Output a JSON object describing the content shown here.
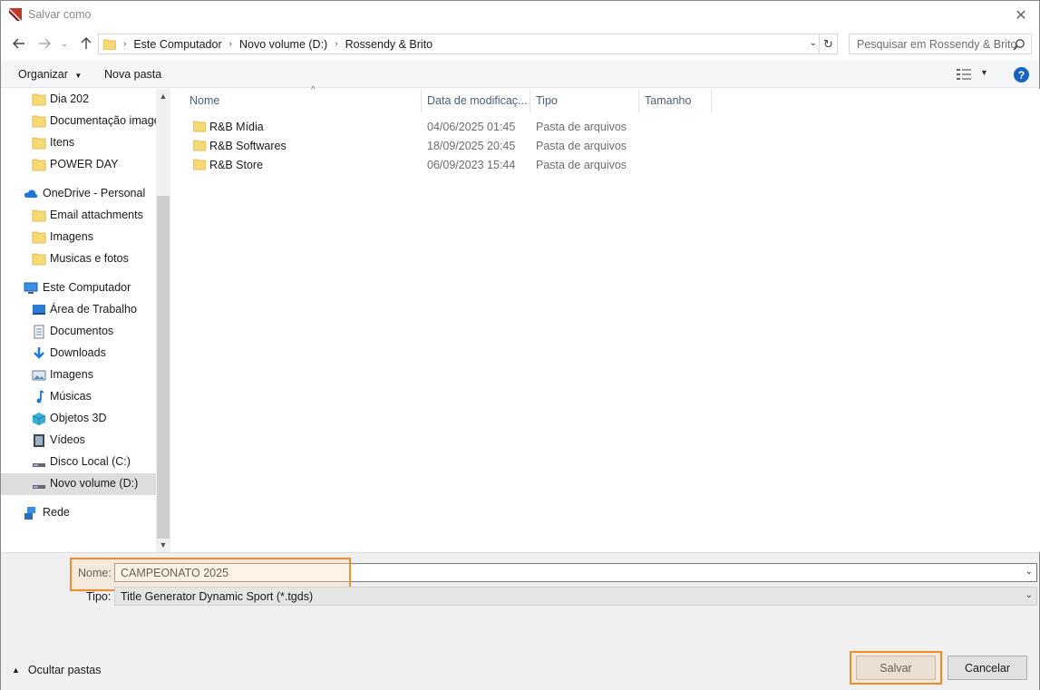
{
  "window": {
    "title": "Salvar como"
  },
  "nav": {
    "breadcrumb": [
      "Este Computador",
      "Novo volume (D:)",
      "Rossendy & Brito"
    ],
    "search_placeholder": "Pesquisar em Rossendy & Brito"
  },
  "toolbar": {
    "organize": "Organizar",
    "new_folder": "Nova pasta"
  },
  "sidebar": {
    "items": [
      {
        "label": "Dia 202",
        "icon": "folder-icon"
      },
      {
        "label": "Documentação image",
        "icon": "folder-icon"
      },
      {
        "label": "Itens",
        "icon": "folder-icon"
      },
      {
        "label": "POWER DAY",
        "icon": "folder-icon"
      },
      {
        "label": "OneDrive - Personal",
        "icon": "cloud-icon"
      },
      {
        "label": "Email attachments",
        "icon": "folder-icon"
      },
      {
        "label": "Imagens",
        "icon": "folder-icon"
      },
      {
        "label": "Musicas e fotos",
        "icon": "folder-icon"
      },
      {
        "label": "Este Computador",
        "icon": "computer-icon"
      },
      {
        "label": "Área de Trabalho",
        "icon": "desktop-icon"
      },
      {
        "label": "Documentos",
        "icon": "documents-icon"
      },
      {
        "label": "Downloads",
        "icon": "download-icon"
      },
      {
        "label": "Imagens",
        "icon": "pictures-icon"
      },
      {
        "label": "Músicas",
        "icon": "music-icon"
      },
      {
        "label": "Objetos 3D",
        "icon": "cube-icon"
      },
      {
        "label": "Vídeos",
        "icon": "video-icon"
      },
      {
        "label": "Disco Local (C:)",
        "icon": "drive-icon"
      },
      {
        "label": "Novo volume (D:)",
        "icon": "drive-icon"
      },
      {
        "label": "Rede",
        "icon": "network-icon"
      }
    ]
  },
  "files": {
    "columns": [
      "Nome",
      "Data de modificaç...",
      "Tipo",
      "Tamanho"
    ],
    "rows": [
      {
        "name": "R&B Mídia",
        "date": "04/06/2025 01:45",
        "type": "Pasta de arquivos"
      },
      {
        "name": "R&B Softwares",
        "date": "18/09/2025 20:45",
        "type": "Pasta de arquivos"
      },
      {
        "name": "R&B Store",
        "date": "06/09/2023 15:44",
        "type": "Pasta de arquivos"
      }
    ]
  },
  "form": {
    "name_label": "Nome:",
    "name_value": "CAMPEONATO 2025",
    "type_label": "Tipo:",
    "type_value": "Title Generator Dynamic Sport (*.tgds)"
  },
  "footer": {
    "hide_folders": "Ocultar pastas",
    "save": "Salvar",
    "cancel": "Cancelar"
  },
  "colors": {
    "highlight": "#f28c28",
    "folder": "#f8d775",
    "help": "#1565c0",
    "selected": "#dddddd"
  }
}
